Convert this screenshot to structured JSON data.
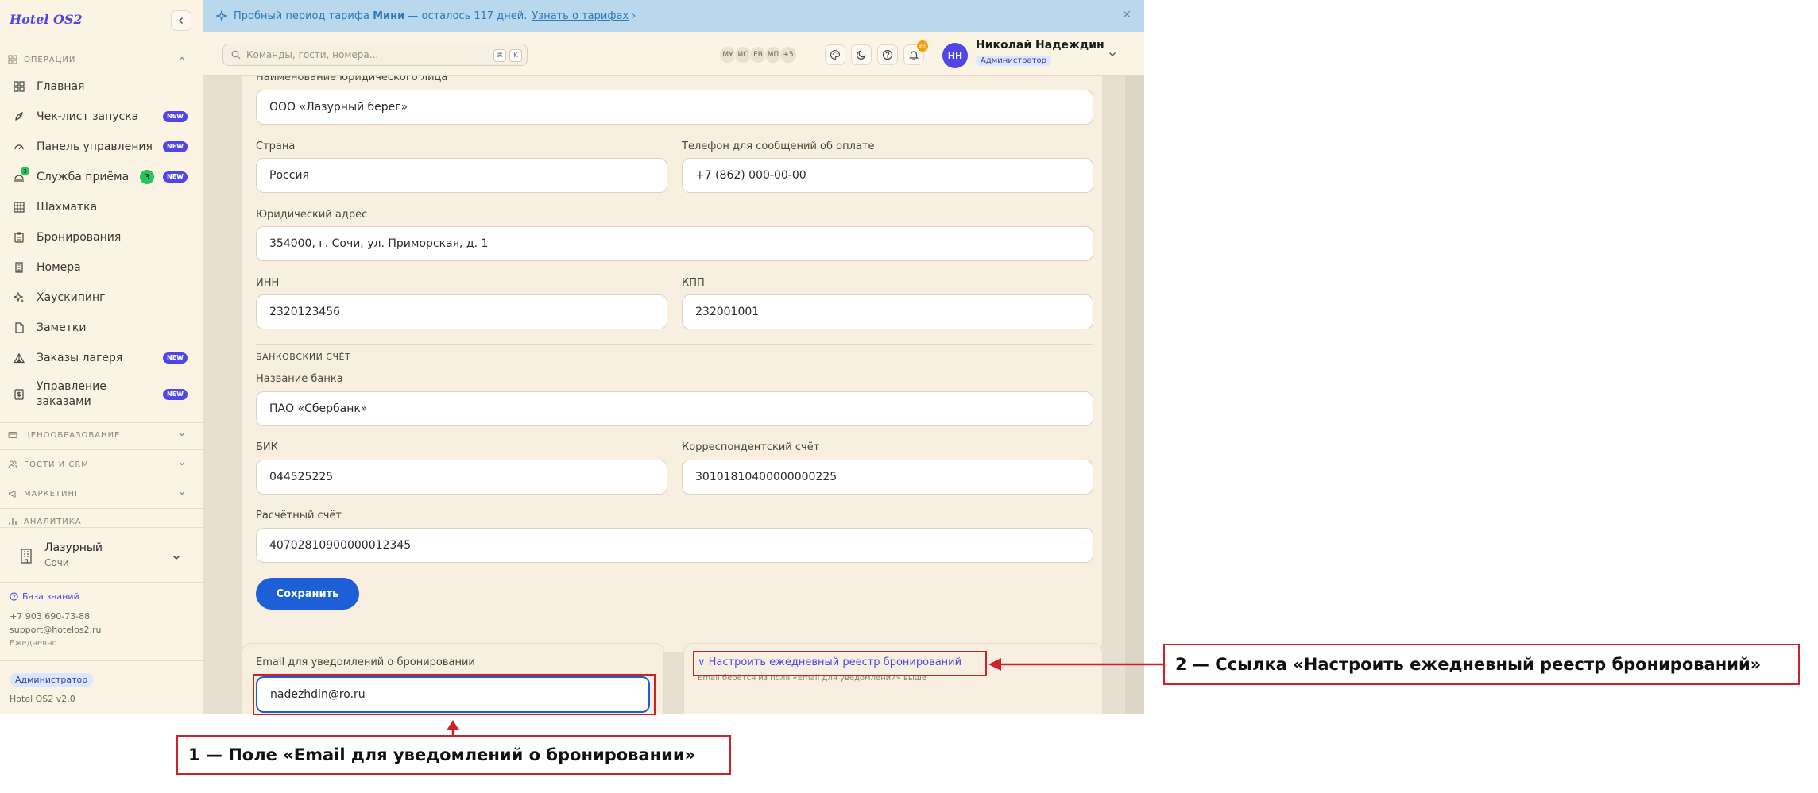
{
  "app": {
    "logo": "Hotel OS2"
  },
  "sidebar": {
    "sections": {
      "operations": "ОПЕРАЦИИ",
      "pricing": "ЦЕНООБРАЗОВАНИЕ",
      "guests": "ГОСТИ И CRM",
      "marketing": "МАРКЕТИНГ",
      "analytics": "АНАЛИТИКА"
    },
    "items": [
      {
        "label": "Главная"
      },
      {
        "label": "Чек-лист запуска",
        "badge": "NEW"
      },
      {
        "label": "Панель управления",
        "badge": "NEW"
      },
      {
        "label": "Служба приёма",
        "badge": "NEW",
        "count": "3",
        "icon_count": "3"
      },
      {
        "label": "Шахматка"
      },
      {
        "label": "Бронирования"
      },
      {
        "label": "Номера"
      },
      {
        "label": "Хаускипинг"
      },
      {
        "label": "Заметки"
      },
      {
        "label": "Заказы лагеря",
        "badge": "NEW"
      },
      {
        "label": "Управление заказами",
        "label_line2": "заказами",
        "label_line1": "Управление",
        "badge": "NEW"
      }
    ],
    "hotel": {
      "name": "Лазурный",
      "city": "Сочи"
    },
    "footer": {
      "kb_link": "База знаний",
      "phone": "+7 903 690-73-88",
      "email": "support@hotelos2.ru",
      "schedule": "Ежедневно",
      "role": "Администратор",
      "version": "Hotel OS2 v2.0"
    }
  },
  "banner": {
    "prefix": "Пробный период тарифа",
    "plan": "Мини",
    "suffix": "— осталось 117 дней.",
    "link": "Узнать о тарифах"
  },
  "topbar": {
    "search_placeholder": "Команды, гости, номера...",
    "kbd1": "⌘",
    "kbd2": "K",
    "avatars": [
      "МУ",
      "ИС",
      "ЕВ",
      "МП",
      "+5"
    ],
    "notif_count": "9+",
    "user": {
      "initials": "НН",
      "name": "Николай Надеждин",
      "role": "Администратор"
    }
  },
  "form": {
    "legal_name_label": "Наименование юридического лица",
    "legal_name": "ООО «Лазурный берег»",
    "country_label": "Страна",
    "country": "Россия",
    "phone_label": "Телефон для сообщений об оплате",
    "phone": "+7 (862) 000-00-00",
    "address_label": "Юридический адрес",
    "address": "354000, г. Сочи, ул. Приморская, д. 1",
    "inn_label": "ИНН",
    "inn": "2320123456",
    "kpp_label": "КПП",
    "kpp": "232001001",
    "bank_section": "БАНКОВСКИЙ СЧЁТ",
    "bank_label": "Название банка",
    "bank": "ПАО «Сбербанк»",
    "bik_label": "БИК",
    "bik": "044525225",
    "corr_label": "Корреспондентский счёт",
    "corr": "30101810400000000225",
    "account_label": "Расчётный счёт",
    "account": "40702810900000012345",
    "save": "Сохранить"
  },
  "email_card": {
    "label": "Email для уведомлений о бронировании",
    "value": "nadezhdin@ro.ru"
  },
  "registry_card": {
    "link": "∨ Настроить ежедневный реестр бронирований",
    "hint": "Email берётся из поля «Email для уведомлений» выше"
  },
  "annotations": {
    "one": "1 — Поле «Email для уведомлений о бронировании»",
    "two": "2 — Ссылка «Настроить ежедневный реестр бронирований»"
  },
  "colors": {
    "accent": "#4f46e5",
    "primary": "#1d5fd6",
    "annotation": "#d0202a",
    "banner": "#b9d8ee"
  }
}
